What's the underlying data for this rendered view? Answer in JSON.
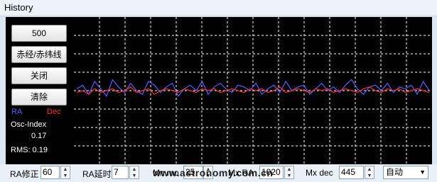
{
  "window": {
    "title": "History"
  },
  "buttons": [
    {
      "label": "500"
    },
    {
      "label": "赤经/赤纬线"
    },
    {
      "label": "关闭"
    },
    {
      "label": "清除"
    }
  ],
  "legend": {
    "ra": "RA",
    "dec": "Dec",
    "ra_color": "#5a5aff",
    "dec_color": "#ff2b2b"
  },
  "stats": {
    "osc_label": "Osc-Index",
    "osc_value": "0.17",
    "rms_text": "RMS: 0.19"
  },
  "controls": {
    "ra_corr_label": "RA修正",
    "ra_corr_value": "60",
    "ra_delay_label": "RA延时",
    "ra_delay_value": "7",
    "mn_mo_label": "Mn mo",
    "mn_mo_value": "25",
    "mx_ra_label": "Mx RA",
    "mx_ra_value": "1020",
    "mx_dec_label": "Mx dec",
    "mx_dec_value": "445",
    "mode_value": "自动"
  },
  "watermark": "www.astronomy.com.cn",
  "chart_data": {
    "type": "line",
    "series": [
      {
        "name": "RA",
        "color": "#5a5aff",
        "values": [
          0.1,
          0.3,
          -0.2,
          0.5,
          0.1,
          -0.3,
          0.6,
          0.2,
          -0.1,
          0.4,
          0.0,
          -0.2,
          0.5,
          0.3,
          -0.1,
          0.2,
          0.4,
          -0.3,
          0.1,
          0.3,
          0.0,
          0.5,
          -0.2,
          0.2,
          0.4,
          0.1,
          -0.1,
          0.3,
          0.2,
          0.0,
          0.4,
          -0.2,
          0.1,
          0.3,
          -0.1,
          0.5,
          0.0,
          0.2,
          0.3,
          -0.2,
          0.1,
          0.4,
          0.0,
          0.2,
          -0.1,
          0.3,
          0.6,
          0.1,
          -0.2,
          0.2,
          0.3,
          0.0,
          0.4,
          -0.1,
          0.2,
          0.1,
          0.3,
          -0.2,
          0.5,
          0.0
        ]
      },
      {
        "name": "Dec",
        "color": "#ff2b2b",
        "values": [
          -0.1,
          0.0,
          -0.2,
          0.1,
          -0.1,
          0.0,
          0.1,
          -0.1,
          0.0,
          0.2,
          -0.1,
          0.0,
          0.1,
          -0.2,
          0.0,
          0.1,
          0.0,
          -0.1,
          0.1,
          0.0,
          -0.1,
          0.1,
          0.0,
          0.1,
          -0.1,
          0.0,
          0.1,
          0.0,
          -0.1,
          0.1,
          0.0,
          0.1,
          -0.1,
          0.0,
          0.2,
          -0.1,
          0.0,
          0.1,
          0.0,
          -0.1,
          0.1,
          0.0,
          0.1,
          -0.1,
          0.0,
          0.1,
          0.0,
          -0.1,
          0.1,
          0.2,
          0.0,
          -0.1,
          0.1,
          0.0,
          0.1,
          -0.1,
          0.0,
          0.1,
          0.0,
          -0.1
        ]
      }
    ],
    "ylim": [
      -4,
      4
    ],
    "grid": true
  }
}
